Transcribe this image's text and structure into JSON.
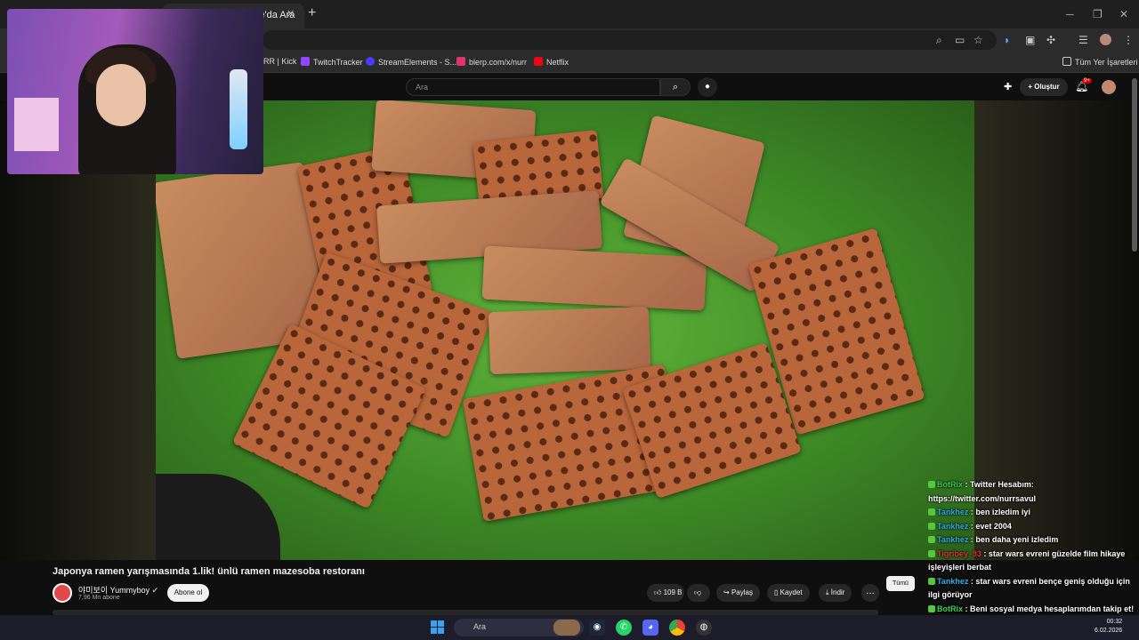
{
  "browser": {
    "active_tab_title": "Google'da Ara",
    "bookmarks": [
      {
        "label": "RR | Kick",
        "color": "#53fc18"
      },
      {
        "label": "TwitchTracker",
        "color": "#9146ff"
      },
      {
        "label": "StreamElements - S...",
        "color": "#4a3cff"
      },
      {
        "label": "blerp.com/x/nurr",
        "color": "#e0336f"
      },
      {
        "label": "Netflix",
        "color": "#e50914"
      }
    ],
    "all_bookmarks": "Tüm Yer İşaretleri"
  },
  "youtube": {
    "search_placeholder": "Ara",
    "create_label": "Oluştur",
    "notification_count": "9+",
    "video": {
      "title": "Japonya ramen yarışmasında 1.lik! ünlü ramen mazesoba restoranı",
      "channel_name": "야미보이 Yummyboy",
      "subscribers": "7,96 Mn abone",
      "subscribe_label": "Abone ol",
      "likes": "109 B",
      "share_label": "Paylaş",
      "save_label": "Kaydet",
      "download_label": "İndir"
    },
    "chip_all": "Tümü"
  },
  "chat": [
    {
      "user": "BotRix",
      "color": "green",
      "text": "Twitter Hesabım: https://twitter.com/nurrsavul"
    },
    {
      "user": "Tankhez",
      "color": "blue",
      "text": "ben izledim iyi"
    },
    {
      "user": "Tankhez",
      "color": "blue",
      "text": "evet 2004"
    },
    {
      "user": "Tankhez",
      "color": "blue",
      "text": "ben daha yeni izledim"
    },
    {
      "user": "Tigribey_93",
      "color": "red",
      "text": "star wars evreni güzelde film hikaye işleyişleri berbat"
    },
    {
      "user": "Tankhez",
      "color": "blue",
      "text": "star wars evreni bençe geniş olduğu için ilgi görüyor"
    },
    {
      "user": "BotRix",
      "color": "green",
      "text": "Beni sosyal medya hesaplarımdan takip et! X: https://twitter.com/NURRsavul Instagram: https://www.instagram.com/nurcennetseker/"
    }
  ],
  "taskbar": {
    "search_placeholder": "Ara",
    "time": "00:32",
    "date": "6.02.2026"
  },
  "colors": {
    "accent_red": "#cc0000",
    "chat_blue": "#2ab3e6",
    "chat_green": "#39d353"
  }
}
